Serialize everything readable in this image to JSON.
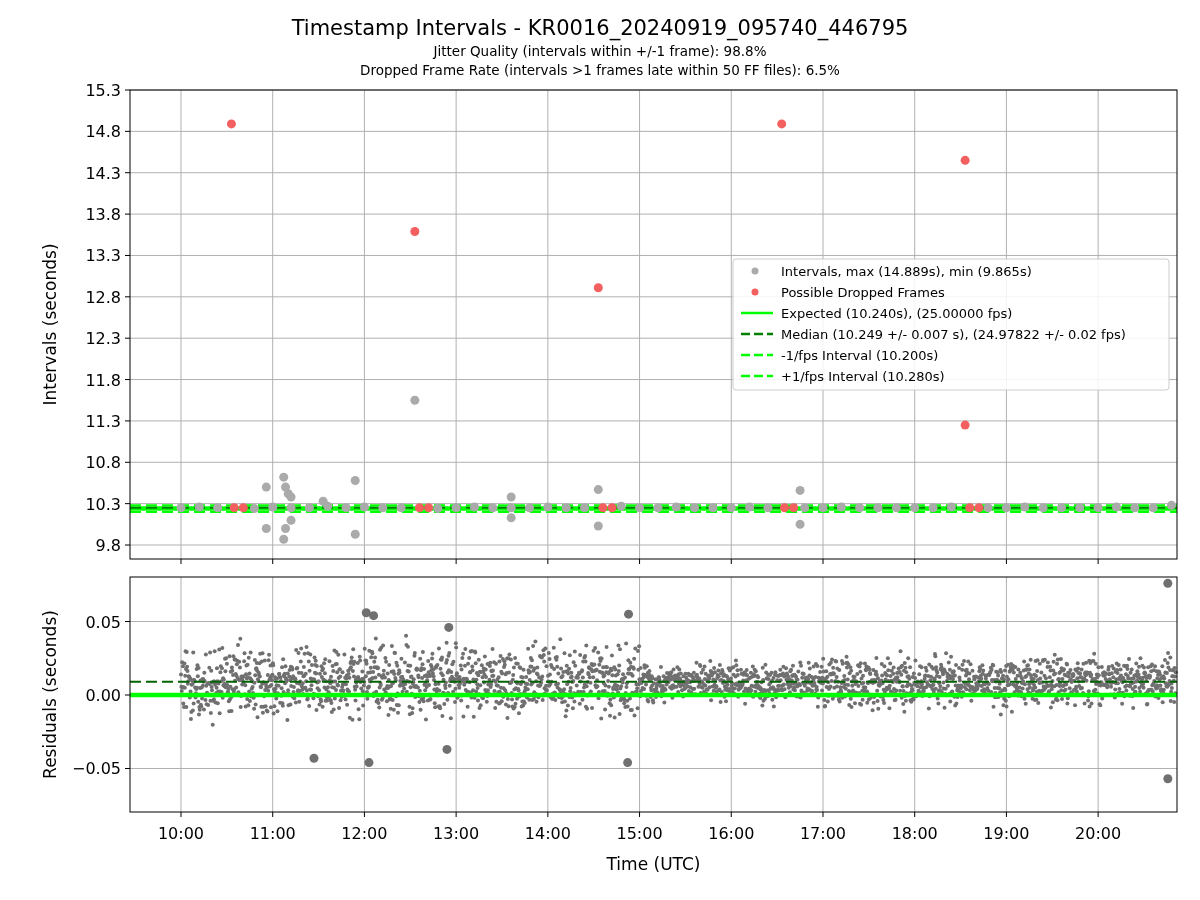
{
  "title": "Timestamp Intervals - KR0016_20240919_095740_446795",
  "subtitles": [
    "Jitter Quality (intervals within +/-1 frame): 98.8%",
    "Dropped Frame Rate (intervals >1 frames late within 50 FF files): 6.5%"
  ],
  "intervals_chart": {
    "chart_data": {
      "type": "scatter",
      "ylabel": "Intervals (seconds)",
      "xlim": [
        9.444,
        20.86
      ],
      "ylim": [
        9.631,
        15.3
      ],
      "grid": true,
      "yticks": [
        {
          "value": 9.8,
          "label": "9.8"
        },
        {
          "value": 10.3,
          "label": "10.3"
        },
        {
          "value": 10.8,
          "label": "10.8"
        },
        {
          "value": 11.3,
          "label": "11.3"
        },
        {
          "value": 11.8,
          "label": "11.8"
        },
        {
          "value": 12.3,
          "label": "12.3"
        },
        {
          "value": 12.8,
          "label": "12.8"
        },
        {
          "value": 13.3,
          "label": "13.3"
        },
        {
          "value": 13.8,
          "label": "13.8"
        },
        {
          "value": 14.3,
          "label": "14.3"
        },
        {
          "value": 14.8,
          "label": "14.8"
        },
        {
          "value": 15.3,
          "label": "15.3"
        }
      ],
      "series": [
        {
          "name": "Intervals, max (14.889s), min (9.865s)",
          "type": "scatter",
          "color": "#aaaaaa",
          "x": [
            10.0,
            10.2,
            10.4,
            10.8,
            11.0,
            11.2,
            11.4,
            11.6,
            11.8,
            12.0,
            12.2,
            12.4,
            12.8,
            13.0,
            13.2,
            13.4,
            13.6,
            13.8,
            14.0,
            14.2,
            14.4,
            14.8,
            15.0,
            15.2,
            15.4,
            15.6,
            15.8,
            16.0,
            16.2,
            16.4,
            16.8,
            17.0,
            17.2,
            17.4,
            17.6,
            17.8,
            18.0,
            18.2,
            18.4,
            18.8,
            19.0,
            19.2,
            19.4,
            19.6,
            19.8,
            20.0,
            20.2,
            20.4,
            20.6,
            20.8,
            10.93,
            10.93,
            11.12,
            11.14,
            11.17,
            11.2,
            11.12,
            11.14,
            11.2,
            11.55,
            11.9,
            11.9,
            12.55,
            13.6,
            13.6,
            14.55,
            14.55,
            16.75,
            16.75
          ],
          "values": [
            10.25,
            10.26,
            10.25,
            10.24,
            10.26,
            10.25,
            10.25,
            10.27,
            10.25,
            10.26,
            10.25,
            10.25,
            10.24,
            10.25,
            10.26,
            10.25,
            10.25,
            10.25,
            10.26,
            10.25,
            10.25,
            10.27,
            10.25,
            10.25,
            10.26,
            10.25,
            10.25,
            10.25,
            10.26,
            10.25,
            10.25,
            10.25,
            10.26,
            10.25,
            10.25,
            10.25,
            10.25,
            10.25,
            10.26,
            10.25,
            10.25,
            10.26,
            10.25,
            10.25,
            10.25,
            10.25,
            10.26,
            10.25,
            10.25,
            10.28,
            10.5,
            10.0,
            10.62,
            10.5,
            10.42,
            10.38,
            9.87,
            10.0,
            10.1,
            10.33,
            10.58,
            9.93,
            11.55,
            10.38,
            10.13,
            10.47,
            10.03,
            10.46,
            10.05
          ]
        },
        {
          "name": "Possible Dropped Frames",
          "type": "scatter",
          "color": "#f46060",
          "x": [
            10.55,
            12.55,
            14.55,
            16.55,
            18.55,
            18.55,
            10.58,
            10.68,
            12.6,
            12.7,
            14.6,
            14.7,
            16.58,
            16.68,
            18.6,
            18.7
          ],
          "values": [
            14.89,
            13.59,
            12.91,
            14.89,
            14.45,
            11.25,
            10.25,
            10.25,
            10.25,
            10.25,
            10.25,
            10.25,
            10.25,
            10.25,
            10.25,
            10.25
          ]
        },
        {
          "name": "Expected (10.240s), (25.00000 fps)",
          "type": "line",
          "line_style": "solid",
          "color": "#00ff00",
          "x": [
            9.444,
            20.86
          ],
          "values": [
            10.24,
            10.24
          ]
        },
        {
          "name": "Median (10.249 +/- 0.007 s), (24.97822 +/- 0.02 fps)",
          "type": "line",
          "line_style": "dashed",
          "color": "#008000",
          "x": [
            9.444,
            20.86
          ],
          "values": [
            10.249,
            10.249
          ]
        },
        {
          "name": "-1/fps Interval (10.200s)",
          "type": "line",
          "line_style": "dashed",
          "color": "#00ff00",
          "x": [
            9.444,
            20.86
          ],
          "values": [
            10.2,
            10.2
          ]
        },
        {
          "name": "+1/fps Interval (10.280s)",
          "type": "line",
          "line_style": "dashed",
          "color": "#00ff00",
          "x": [
            9.444,
            20.86
          ],
          "values": [
            10.28,
            10.28
          ]
        }
      ]
    }
  },
  "residuals_chart": {
    "chart_data": {
      "type": "scatter",
      "xlabel": "Time (UTC)",
      "ylabel": "Residuals (seconds)",
      "xlim": [
        9.444,
        20.86
      ],
      "ylim": [
        -0.0796,
        0.0803
      ],
      "grid": true,
      "xticks": [
        {
          "value": 10,
          "label": "10:00"
        },
        {
          "value": 11,
          "label": "11:00"
        },
        {
          "value": 12,
          "label": "12:00"
        },
        {
          "value": 13,
          "label": "13:00"
        },
        {
          "value": 14,
          "label": "14:00"
        },
        {
          "value": 15,
          "label": "15:00"
        },
        {
          "value": 16,
          "label": "16:00"
        },
        {
          "value": 17,
          "label": "17:00"
        },
        {
          "value": 18,
          "label": "18:00"
        },
        {
          "value": 19,
          "label": "19:00"
        },
        {
          "value": 20,
          "label": "20:00"
        }
      ],
      "yticks": [
        {
          "value": -0.05,
          "label": "−0.05"
        },
        {
          "value": 0,
          "label": "0.00"
        },
        {
          "value": 0.05,
          "label": "0.05"
        }
      ],
      "series": [
        {
          "type": "scatter",
          "color": "#707070",
          "x": [
            12.02,
            12.1,
            11.45,
            12.9,
            14.87,
            20.76,
            20.76,
            14.88,
            12.05,
            12.92
          ],
          "values": [
            0.056,
            0.054,
            -0.043,
            -0.037,
            -0.046,
            0.076,
            -0.057,
            0.055,
            -0.046,
            0.046
          ]
        },
        {
          "type": "line",
          "line_style": "solid",
          "color": "#00ff00",
          "x": [
            9.444,
            20.86
          ],
          "values": [
            0,
            0
          ]
        },
        {
          "type": "line",
          "line_style": "dashed",
          "color": "#006400",
          "x": [
            9.444,
            20.86
          ],
          "values": [
            0.009,
            0.009
          ]
        }
      ]
    }
  }
}
